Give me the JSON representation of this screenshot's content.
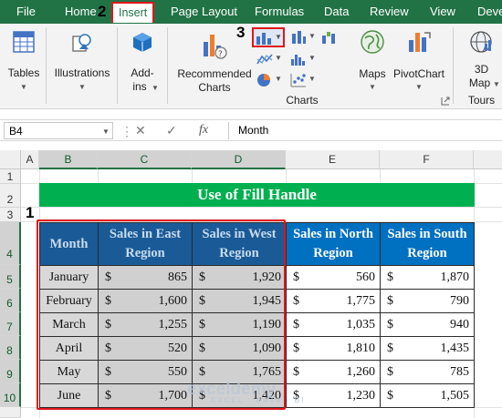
{
  "menu": {
    "tabs": [
      "File",
      "Home",
      "Insert",
      "Page Layout",
      "Formulas",
      "Data",
      "Review",
      "View",
      "Deve"
    ],
    "active": "Insert"
  },
  "steps": {
    "s1": "1",
    "s2": "2",
    "s3": "3"
  },
  "ribbon": {
    "tables": "Tables",
    "illustrations": "Illustrations",
    "addins_1": "Add-",
    "addins_2": "ins",
    "recommended_1": "Recommended",
    "recommended_2": "Charts",
    "maps": "Maps",
    "pivotchart": "PivotChart",
    "map3d_1": "3D",
    "map3d_2": "Map",
    "charts_group": "Charts",
    "tours_group": "Tours"
  },
  "formula_bar": {
    "name_box": "B4",
    "cancel": "✕",
    "confirm": "✓",
    "fx": "fx",
    "value": "Month"
  },
  "grid": {
    "columns": [
      "A",
      "B",
      "C",
      "D",
      "E",
      "F"
    ],
    "rows": [
      "1",
      "2",
      "3",
      "4",
      "5",
      "6",
      "7",
      "8",
      "9",
      "10"
    ]
  },
  "sheet": {
    "title": "Use of Fill Handle",
    "headers": [
      "Month",
      "Sales in East Region",
      "Sales in West Region",
      "Sales in North Region",
      "Sales in South Region"
    ],
    "currency": "$",
    "rows": [
      {
        "month": "January",
        "east": "865",
        "west": "1,920",
        "north": "560",
        "south": "1,870"
      },
      {
        "month": "February",
        "east": "1,600",
        "west": "1,945",
        "north": "1,775",
        "south": "790"
      },
      {
        "month": "March",
        "east": "1,255",
        "west": "1,190",
        "north": "1,035",
        "south": "940"
      },
      {
        "month": "April",
        "east": "520",
        "west": "1,090",
        "north": "1,810",
        "south": "1,435"
      },
      {
        "month": "May",
        "east": "550",
        "west": "1,765",
        "north": "1,260",
        "south": "785"
      },
      {
        "month": "June",
        "east": "1,700",
        "west": "1,420",
        "north": "1,230",
        "south": "1,505"
      }
    ]
  },
  "watermark": {
    "name": "exceldemy",
    "tagline": "EXCEL · DATA · BI"
  },
  "colors": {
    "excel_green": "#217346",
    "header_blue": "#0070c0",
    "title_green": "#00b050",
    "highlight_red": "#e0161c"
  }
}
